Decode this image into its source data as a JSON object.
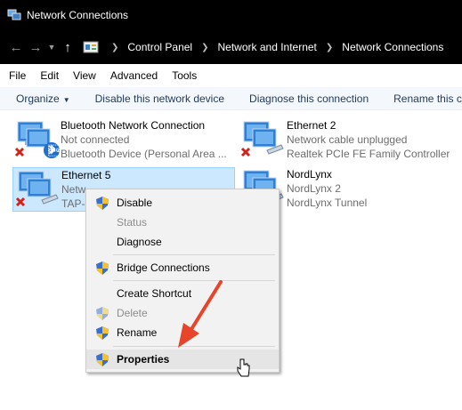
{
  "window": {
    "title": "Network Connections"
  },
  "address": {
    "crumbs": [
      "Control Panel",
      "Network and Internet",
      "Network Connections"
    ]
  },
  "menu": [
    "File",
    "Edit",
    "View",
    "Advanced",
    "Tools"
  ],
  "commands": {
    "organize": "Organize",
    "disable": "Disable this network device",
    "diagnose": "Diagnose this connection",
    "rename": "Rename this c"
  },
  "connections": [
    {
      "name": "Bluetooth Network Connection",
      "status": "Not connected",
      "device": "Bluetooth Device (Personal Area ..."
    },
    {
      "name": "Ethernet 2",
      "status": "Network cable unplugged",
      "device": "Realtek PCIe FE Family Controller"
    },
    {
      "name": "Ethernet 5",
      "status": "Netw",
      "device": "TAP-"
    },
    {
      "name": "NordLynx",
      "status": "NordLynx 2",
      "device": "NordLynx Tunnel"
    }
  ],
  "context_menu": {
    "disable": "Disable",
    "status": "Status",
    "diagnose": "Diagnose",
    "bridge": "Bridge Connections",
    "shortcut": "Create Shortcut",
    "delete": "Delete",
    "rename": "Rename",
    "properties": "Properties"
  },
  "colors": {
    "accent_arrow": "#e8442a",
    "selection": "#cce8ff"
  }
}
